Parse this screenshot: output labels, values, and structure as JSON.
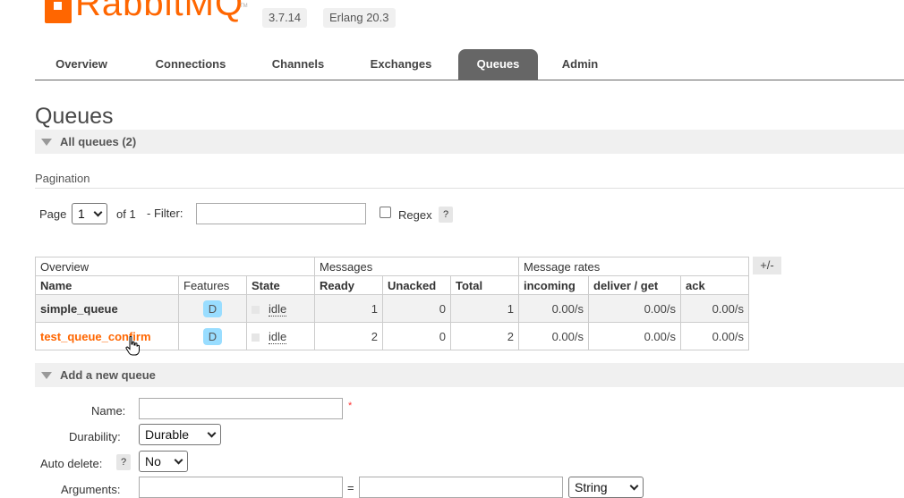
{
  "header": {
    "logo_text": "RabbitMQ",
    "logo_tm": "TM",
    "version": "3.7.14",
    "erlang": "Erlang 20.3"
  },
  "tabs": [
    {
      "label": "Overview"
    },
    {
      "label": "Connections"
    },
    {
      "label": "Channels"
    },
    {
      "label": "Exchanges"
    },
    {
      "label": "Queues",
      "active": true
    },
    {
      "label": "Admin"
    }
  ],
  "page_title": "Queues",
  "all_queues": {
    "label": "All queues (2)"
  },
  "pagination": {
    "heading": "Pagination",
    "page_label": "Page",
    "page_value": "1",
    "of_label": "of 1",
    "filter_label": "- Filter:",
    "filter_value": "",
    "regex_label": "Regex",
    "help": "?"
  },
  "table": {
    "groups": [
      "Overview",
      "Messages",
      "Message rates"
    ],
    "plus_minus": "+/-",
    "columns": [
      "Name",
      "Features",
      "State",
      "Ready",
      "Unacked",
      "Total",
      "incoming",
      "deliver / get",
      "ack"
    ],
    "rows": [
      {
        "name": "simple_queue",
        "feature": "D",
        "state": "idle",
        "ready": "1",
        "unacked": "0",
        "total": "1",
        "incoming": "0.00/s",
        "deliver": "0.00/s",
        "ack": "0.00/s"
      },
      {
        "name": "test_queue_confirm",
        "feature": "D",
        "state": "idle",
        "ready": "2",
        "unacked": "0",
        "total": "2",
        "incoming": "0.00/s",
        "deliver": "0.00/s",
        "ack": "0.00/s"
      }
    ]
  },
  "add_queue": {
    "label": "Add a new queue",
    "name_label": "Name:",
    "name_value": "",
    "required_mark": "*",
    "durability_label": "Durability:",
    "durability_value": "Durable",
    "auto_delete_label": "Auto delete:",
    "auto_delete_help": "?",
    "auto_delete_value": "No",
    "arguments_label": "Arguments:",
    "equals": "=",
    "arg_type_value": "String"
  },
  "colors": {
    "accent": "#ff6600",
    "tab_active": "#666666",
    "badge": "#99ddff"
  }
}
